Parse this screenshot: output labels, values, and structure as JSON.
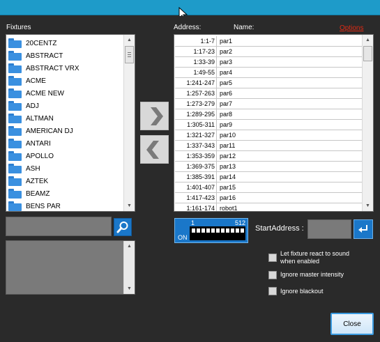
{
  "labels": {
    "fixtures": "Fixtures",
    "address": "Address:",
    "name": "Name:",
    "options": "Options",
    "start_address": "StartAddress :"
  },
  "fixtures": [
    "20CENTZ",
    "ABSTRACT",
    "ABSTRACT VRX",
    "ACME",
    "ACME NEW",
    "ADJ",
    "ALTMAN",
    "AMERICAN DJ",
    "ANTARI",
    "APOLLO",
    "ASH",
    "AZTEK",
    "BEAMZ",
    "BENS PAR"
  ],
  "patch": [
    {
      "address": "1:1-7",
      "name": "par1"
    },
    {
      "address": "1:17-23",
      "name": "par2"
    },
    {
      "address": "1:33-39",
      "name": "par3"
    },
    {
      "address": "1:49-55",
      "name": "par4"
    },
    {
      "address": "1:241-247",
      "name": "par5"
    },
    {
      "address": "1:257-263",
      "name": "par6"
    },
    {
      "address": "1:273-279",
      "name": "par7"
    },
    {
      "address": "1:289-295",
      "name": "par8"
    },
    {
      "address": "1:305-311",
      "name": "par9"
    },
    {
      "address": "1:321-327",
      "name": "par10"
    },
    {
      "address": "1:337-343",
      "name": "par11"
    },
    {
      "address": "1:353-359",
      "name": "par12"
    },
    {
      "address": "1:369-375",
      "name": "par13"
    },
    {
      "address": "1:385-391",
      "name": "par14"
    },
    {
      "address": "1:401-407",
      "name": "par15"
    },
    {
      "address": "1:417-423",
      "name": "par16"
    },
    {
      "address": "1:161-174",
      "name": "robot1"
    }
  ],
  "dmx": {
    "first": "1",
    "last": "512",
    "status": "ON"
  },
  "checkboxes": [
    {
      "label": "Let fixture react to sound when enabled",
      "checked": false
    },
    {
      "label": "Ignore master intensity",
      "checked": false
    },
    {
      "label": "Ignore blackout",
      "checked": false
    }
  ],
  "buttons": {
    "close": "Close"
  },
  "icons": {
    "search": "search-icon",
    "add": "chevron-right-icon",
    "remove": "chevron-left-icon",
    "enter": "enter-icon",
    "folder": "folder-icon"
  },
  "colors": {
    "titlebar": "#1e9bc9",
    "accent": "#1a77c9",
    "options_link": "#e02a14"
  }
}
